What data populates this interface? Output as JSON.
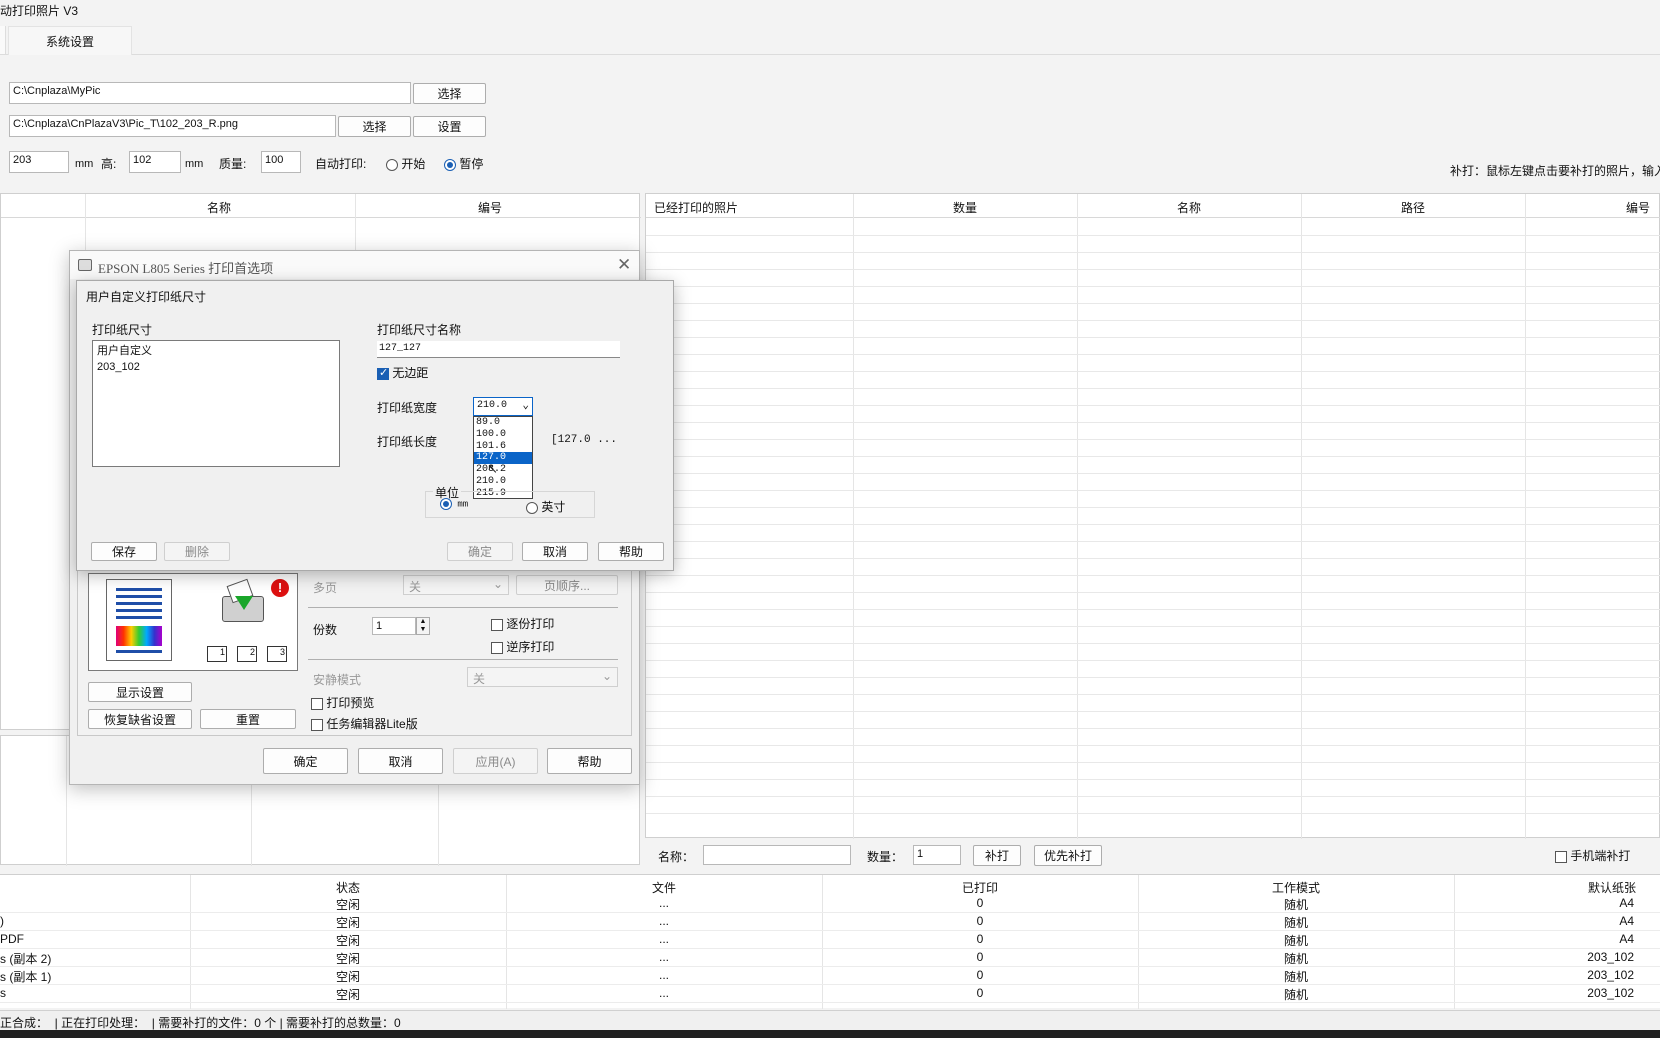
{
  "app": {
    "title": "动打印照片 V3"
  },
  "tabs": [
    {
      "label": "系统设置"
    }
  ],
  "paths": {
    "pic_folder": "C:\\Cnplaza\\MyPic",
    "template_file": "C:\\Cnplaza\\CnPlazaV3\\Pic_T\\102_203_R.png",
    "select_label": "选择",
    "settings_label": "设置"
  },
  "size_row": {
    "width_value": "203",
    "unit": "mm",
    "height_label": "高:",
    "height_value": "102",
    "quality_label": "质量:",
    "quality_value": "100",
    "autoprint_label": "自动打印:",
    "start_label": "开始",
    "pause_label": "暂停",
    "reprint_hint": "补打：鼠标左键点击要补打的照片，输入"
  },
  "left_table": {
    "headers": [
      "名称",
      "编号"
    ]
  },
  "right_table": {
    "headers": [
      "已经打印的照片",
      "数量",
      "名称",
      "路径",
      "编号"
    ]
  },
  "reprint_bar": {
    "name_label": "名称：",
    "count_label": "数量：",
    "count_value": "1",
    "reprint_btn": "补打",
    "priority_btn": "优先补打",
    "mobile_label": "手机端补打"
  },
  "printer_table": {
    "headers": [
      "状态",
      "文件",
      "已打印",
      "工作模式",
      "默认纸张"
    ],
    "rows": [
      {
        "name": "",
        "status": "空闲",
        "file": "...",
        "printed": "0",
        "mode": "随机",
        "paper": "A4"
      },
      {
        "name": ")",
        "status": "空闲",
        "file": "...",
        "printed": "0",
        "mode": "随机",
        "paper": "A4"
      },
      {
        "name": "PDF",
        "status": "空闲",
        "file": "...",
        "printed": "0",
        "mode": "随机",
        "paper": "A4"
      },
      {
        "name": "s (副本 2)",
        "status": "空闲",
        "file": "...",
        "printed": "0",
        "mode": "随机",
        "paper": "203_102"
      },
      {
        "name": "s (副本 1)",
        "status": "空闲",
        "file": "...",
        "printed": "0",
        "mode": "随机",
        "paper": "203_102"
      },
      {
        "name": "s",
        "status": "空闲",
        "file": "...",
        "printed": "0",
        "mode": "随机",
        "paper": "203_102"
      }
    ]
  },
  "statusbar": {
    "text": "正合成：  | 正在打印处理：  | 需要补打的文件：0 个 | 需要补打的总数量：0"
  },
  "epson_dialog": {
    "title": "EPSON L805 Series 打印首选项",
    "multipage_label": "多页",
    "multipage_value": "关",
    "page_order_btn": "页顺序...",
    "copies_label": "份数",
    "copies_value": "1",
    "collate_label": "逐份打印",
    "reverse_label": "逆序打印",
    "quiet_label": "安静模式",
    "quiet_value": "关",
    "preview_label": "打印预览",
    "lite_label": "任务编辑器Lite版",
    "show_settings_btn": "显示设置",
    "restore_btn": "恢复缺省设置",
    "reset_btn": "重置",
    "ok_btn": "确定",
    "cancel_btn": "取消",
    "apply_btn": "应用(A)",
    "help_btn": "帮助"
  },
  "custom_dialog": {
    "title": "用户自定义打印纸尺寸",
    "paper_size_label": "打印纸尺寸",
    "paper_list": [
      "用户自定义",
      "203_102"
    ],
    "size_name_label": "打印纸尺寸名称",
    "size_name_value": "127_127",
    "borderless_label": "无边距",
    "width_label": "打印纸宽度",
    "width_value": "210.0",
    "width_options": [
      "89.0",
      "100.0",
      "101.6",
      "127.0",
      "203.2",
      "210.0",
      "215.9"
    ],
    "width_selected": "127.0",
    "length_label": "打印纸长度",
    "length_range": "[127.0 ...",
    "unit_label": "单位",
    "unit_mm": "mm",
    "unit_inch": "英寸",
    "save_btn": "保存",
    "delete_btn": "删除",
    "ok_btn": "确定",
    "cancel_btn": "取消",
    "help_btn": "帮助"
  }
}
